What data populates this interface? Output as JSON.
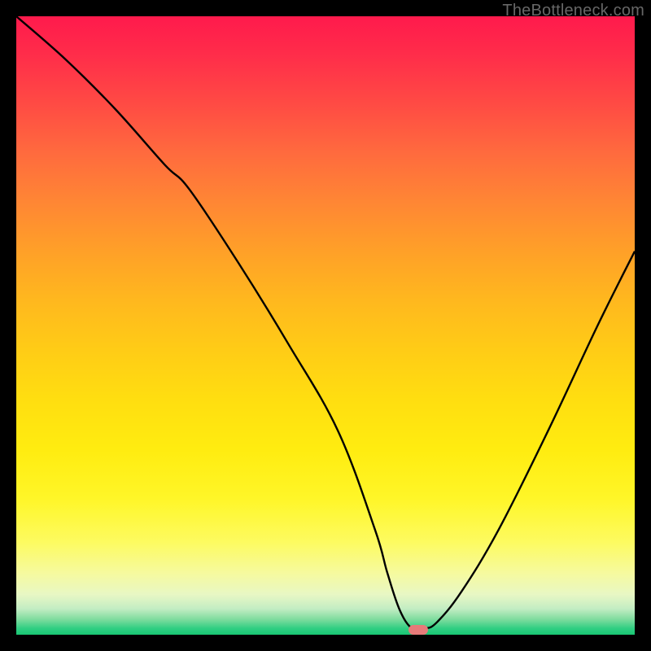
{
  "watermark": "TheBottleneck.com",
  "colors": {
    "gradient_stops": [
      {
        "offset": 0.0,
        "color": "#ff1a4c"
      },
      {
        "offset": 0.06,
        "color": "#ff2c4a"
      },
      {
        "offset": 0.14,
        "color": "#ff4a44"
      },
      {
        "offset": 0.22,
        "color": "#ff6a3e"
      },
      {
        "offset": 0.3,
        "color": "#ff8634"
      },
      {
        "offset": 0.38,
        "color": "#ffa028"
      },
      {
        "offset": 0.46,
        "color": "#ffb81e"
      },
      {
        "offset": 0.54,
        "color": "#ffcc16"
      },
      {
        "offset": 0.62,
        "color": "#ffde10"
      },
      {
        "offset": 0.7,
        "color": "#ffec10"
      },
      {
        "offset": 0.78,
        "color": "#fff628"
      },
      {
        "offset": 0.85,
        "color": "#fdfb60"
      },
      {
        "offset": 0.9,
        "color": "#f6fa9e"
      },
      {
        "offset": 0.935,
        "color": "#e8f7c4"
      },
      {
        "offset": 0.958,
        "color": "#c3edc3"
      },
      {
        "offset": 0.975,
        "color": "#7fdc9e"
      },
      {
        "offset": 0.99,
        "color": "#2fce82"
      },
      {
        "offset": 1.0,
        "color": "#18c673"
      }
    ],
    "line": "#000000",
    "marker": "#e77a79",
    "frame": "#000000"
  },
  "chart_data": {
    "type": "line",
    "title": "",
    "xlabel": "",
    "ylabel": "",
    "xlim": [
      0,
      100
    ],
    "ylim": [
      0,
      100
    ],
    "grid": false,
    "legend": false,
    "comment": "Bottleneck % curve. x=relative position along horizontal axis, y=bottleneck percentage (0=optimal, 100=severe). Minimum near x≈65.",
    "series": [
      {
        "name": "bottleneck-curve",
        "x": [
          0,
          8,
          16,
          24,
          28,
          36,
          44,
          52,
          58,
          60,
          62,
          64,
          66,
          68,
          72,
          78,
          86,
          94,
          100
        ],
        "y": [
          100,
          93,
          85,
          76,
          72,
          60,
          47,
          33,
          17,
          10,
          4,
          1,
          1,
          2,
          7,
          17,
          33,
          50,
          62
        ]
      }
    ],
    "marker": {
      "x": 65,
      "y": 0.8
    }
  }
}
